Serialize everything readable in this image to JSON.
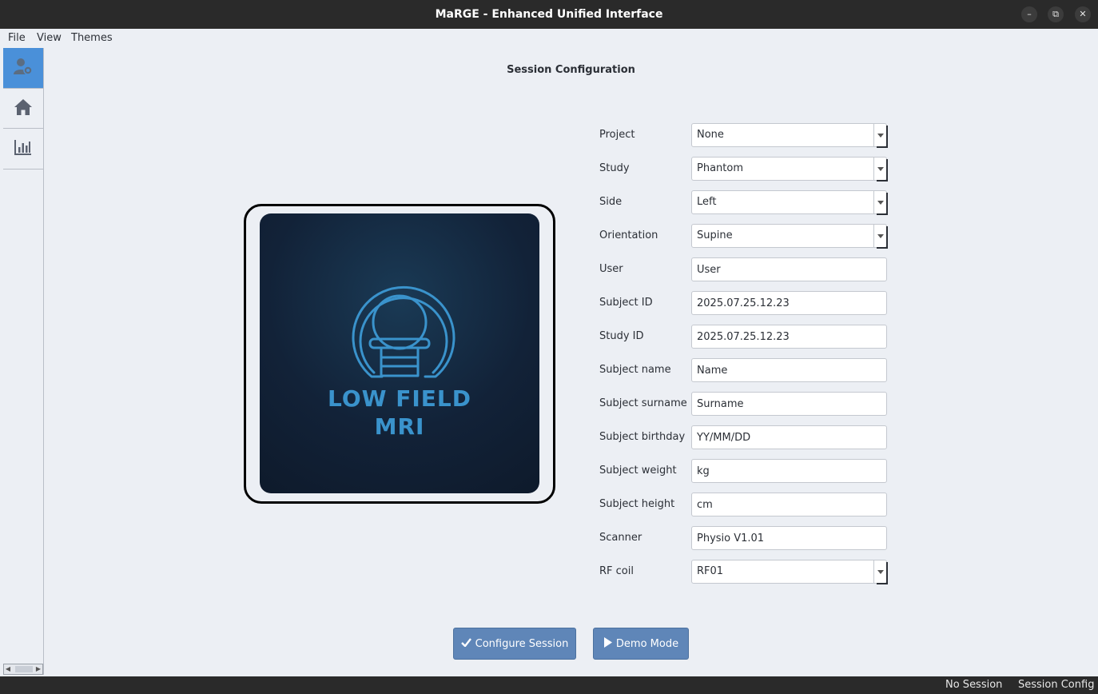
{
  "window": {
    "title": "MaRGE - Enhanced Unified Interface",
    "minimize_icon": "minimize-icon",
    "maximize_icon": "restore-icon",
    "close_icon": "close-icon"
  },
  "menu": {
    "items": [
      {
        "label": "File"
      },
      {
        "label": "View"
      },
      {
        "label": "Themes"
      }
    ]
  },
  "sidebar": {
    "items": [
      {
        "icon": "user-settings-icon",
        "active": true
      },
      {
        "icon": "home-icon",
        "active": false
      },
      {
        "icon": "bar-chart-icon",
        "active": false
      }
    ]
  },
  "main": {
    "title": "Session Configuration",
    "logo": {
      "line1": "LOW FIELD",
      "line2": "MRI",
      "accent": "#3a93cc"
    },
    "form": [
      {
        "label": "Project",
        "type": "combo",
        "value": "None"
      },
      {
        "label": "Study",
        "type": "combo",
        "value": "Phantom"
      },
      {
        "label": "Side",
        "type": "combo",
        "value": "Left"
      },
      {
        "label": "Orientation",
        "type": "combo",
        "value": "Supine"
      },
      {
        "label": "User",
        "type": "text",
        "value": "User"
      },
      {
        "label": "Subject ID",
        "type": "text",
        "value": "2025.07.25.12.23"
      },
      {
        "label": "Study ID",
        "type": "text",
        "value": "2025.07.25.12.23"
      },
      {
        "label": "Subject name",
        "type": "text",
        "value": "Name"
      },
      {
        "label": "Subject surname",
        "type": "text",
        "value": "Surname"
      },
      {
        "label": "Subject birthday",
        "type": "text",
        "value": "YY/MM/DD"
      },
      {
        "label": "Subject weight",
        "type": "text",
        "value": "kg"
      },
      {
        "label": "Subject height",
        "type": "text",
        "value": "cm"
      },
      {
        "label": "Scanner",
        "type": "text",
        "value": "Physio V1.01"
      },
      {
        "label": "RF coil",
        "type": "combo",
        "value": "RF01"
      }
    ],
    "buttons": {
      "configure": {
        "label": "Configure Session",
        "icon": "check-icon"
      },
      "demo": {
        "label": "Demo Mode",
        "icon": "play-icon"
      }
    }
  },
  "status": {
    "session": "No Session",
    "mode": "Session Config"
  },
  "colors": {
    "accent": "#4a90d9",
    "button": "#5f86b8",
    "titlebar": "#2a2a2a",
    "background": "#eceff4"
  }
}
